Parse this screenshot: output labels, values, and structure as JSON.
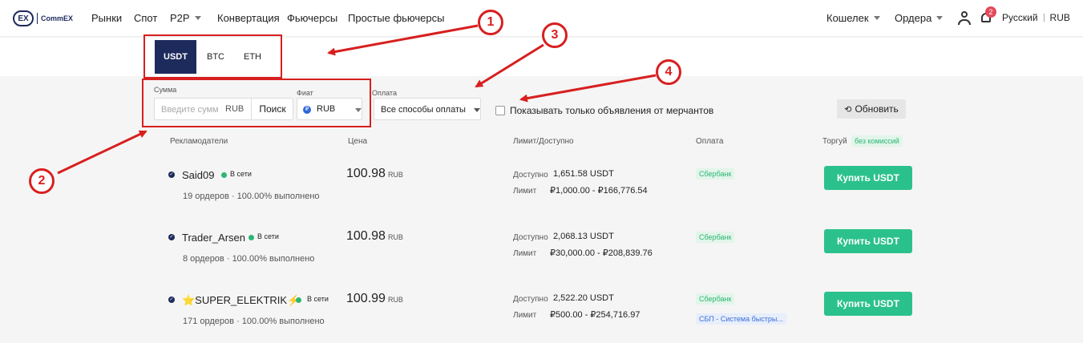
{
  "nav": {
    "logo_mark": "EX",
    "logo_text": "CommEX",
    "items": [
      "Рынки",
      "Спот",
      "P2P",
      "Конвертация",
      "Фьючерсы",
      "Простые фьючерсы"
    ],
    "wallet": "Кошелек",
    "orders": "Ордера",
    "notifications": "2",
    "language": "Русский",
    "currency": "RUB"
  },
  "tabs": [
    "USDT",
    "BTC",
    "ETH"
  ],
  "filters": {
    "amount_label": "Сумма",
    "amount_placeholder": "Введите сумм",
    "amount_currency": "RUB",
    "search_button": "Поиск",
    "fiat_label": "Фиат",
    "fiat_value": "RUB",
    "payment_label": "Оплата",
    "payment_value": "Все способы оплаты",
    "merchant_only": "Показывать только объявления от мерчантов",
    "refresh": "Обновить"
  },
  "table_headers": {
    "advertisers": "Рекламодатели",
    "price": "Цена",
    "limit": "Лимит/Доступно",
    "payment": "Оплата",
    "trade": "Торгуй",
    "no_fee": "без комиссий"
  },
  "rows": [
    {
      "name": "Said09",
      "status": "В сети",
      "orders": "19 ордеров",
      "completion": "100.00% выполнено",
      "price": "100.98",
      "price_unit": "RUB",
      "available_label": "Доступно",
      "available": "1,651.58 USDT",
      "limit_label": "Лимит",
      "limit": "₽1,000.00 - ₽166,776.54",
      "payments": [
        "Сбербанк"
      ],
      "buy": "Купить USDT"
    },
    {
      "name": "Trader_Arsen",
      "status": "В сети",
      "orders": "8 ордеров",
      "completion": "100.00% выполнено",
      "price": "100.98",
      "price_unit": "RUB",
      "available_label": "Доступно",
      "available": "2,068.13 USDT",
      "limit_label": "Лимит",
      "limit": "₽30,000.00 - ₽208,839.76",
      "payments": [
        "Сбербанк"
      ],
      "buy": "Купить USDT"
    },
    {
      "name": "⭐SUPER_ELEKTRIK⚡",
      "status": "В сети",
      "orders": "171 ордеров",
      "completion": "100.00% выполнено",
      "price": "100.99",
      "price_unit": "RUB",
      "available_label": "Доступно",
      "available": "2,522.20 USDT",
      "limit_label": "Лимит",
      "limit": "₽500.00 - ₽254,716.97",
      "payments": [
        "Сбербанк",
        "СБП - Система быстры..."
      ],
      "buy": "Купить USDT"
    }
  ],
  "annotations": [
    "1",
    "2",
    "3",
    "4"
  ],
  "colors": {
    "brand": "#1d2a5c",
    "buy": "#2bc18c",
    "online": "#2bb673",
    "annotation": "#d81f1f"
  }
}
